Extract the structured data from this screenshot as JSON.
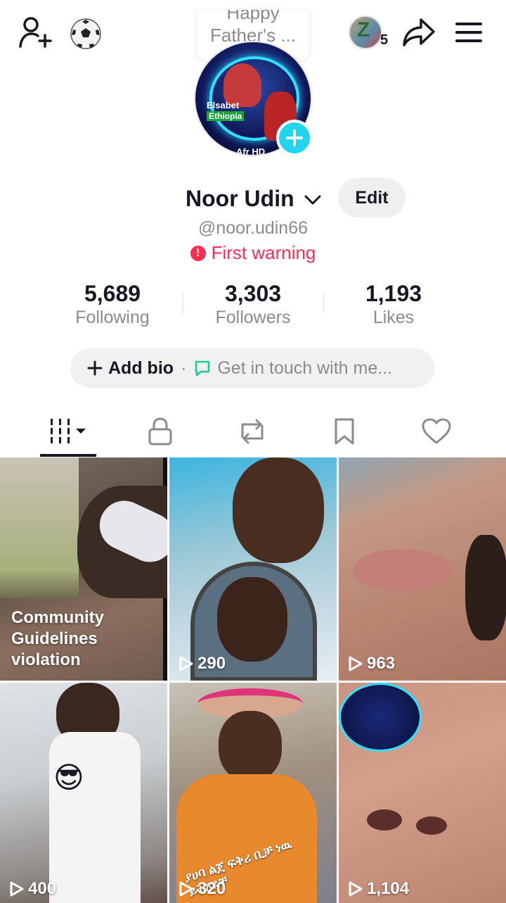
{
  "story": {
    "line1": "Happy",
    "line2": "Father's ..."
  },
  "friends": {
    "count": "5",
    "letter": "Z"
  },
  "avatar_art": {
    "name": "Elsabet",
    "country": "Ethiopia",
    "channel": "Afr HD"
  },
  "profile": {
    "name": "Noor Udin",
    "edit_label": "Edit",
    "handle": "@noor.udin66",
    "warning": "First warning"
  },
  "stats": [
    {
      "value": "5,689",
      "label": "Following"
    },
    {
      "value": "3,303",
      "label": "Followers"
    },
    {
      "value": "1,193",
      "label": "Likes"
    }
  ],
  "bio": {
    "add_label": "Add bio",
    "separator": "·",
    "contact_label": "Get in touch with me..."
  },
  "tabs": [
    {
      "name": "videos",
      "icon": "grid-bars-icon",
      "active": true
    },
    {
      "name": "private",
      "icon": "lock-icon",
      "active": false
    },
    {
      "name": "reposts",
      "icon": "repost-icon",
      "active": false
    },
    {
      "name": "favorites",
      "icon": "bookmark-icon",
      "active": false
    },
    {
      "name": "liked",
      "icon": "heart-icon",
      "active": false
    }
  ],
  "videos": [
    {
      "violation": "Community Guidelines violation",
      "views": ""
    },
    {
      "views": "290"
    },
    {
      "views": "963"
    },
    {
      "views": "400"
    },
    {
      "views": "320",
      "caption": "ያሀባ ልጀ ፍቅሪ ቢቻ ነዉ ይትአዬቸ"
    },
    {
      "views": "1,104"
    }
  ],
  "colors": {
    "text": "#161823",
    "secondary": "#8a8b91",
    "warning": "#fe2c55",
    "accent": "#20d5ec",
    "chat": "#20c997"
  }
}
